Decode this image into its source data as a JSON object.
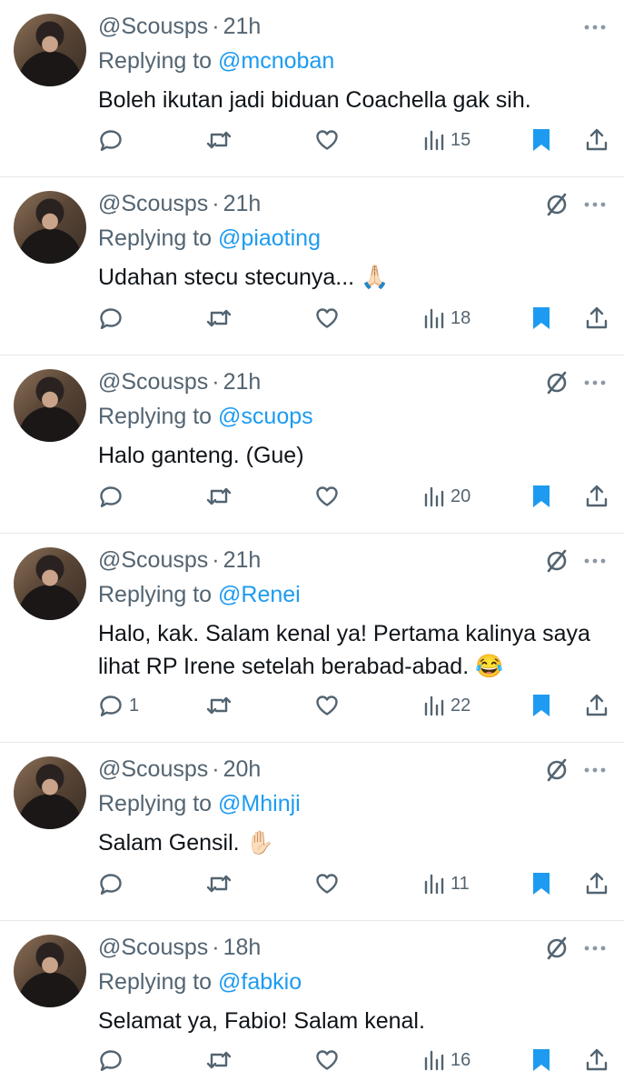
{
  "colors": {
    "accent": "#1d9bf0",
    "muted": "#536471",
    "text": "#0f1419",
    "divider": "#e6e8ea"
  },
  "icons": {
    "reply": "reply-icon",
    "retweet": "retweet-icon",
    "like": "heart-icon",
    "views": "views-icon",
    "bookmark": "bookmark-icon",
    "share": "share-icon",
    "mute": "muted-icon",
    "more": "more-icon"
  },
  "tweets": [
    {
      "handle": "@Scousps",
      "time": "21h",
      "replying_label": "Replying to",
      "mention": "@mcnoban",
      "text": "Boleh ikutan jadi biduan Coachella gak sih.",
      "emoji": "",
      "reply_count": "",
      "views": "15",
      "show_mute": false
    },
    {
      "handle": "@Scousps",
      "time": "21h",
      "replying_label": "Replying to",
      "mention": "@piaoting",
      "text": "Udahan stecu stecunya...",
      "emoji": "🙏🏻",
      "reply_count": "",
      "views": "18",
      "show_mute": true
    },
    {
      "handle": "@Scousps",
      "time": "21h",
      "replying_label": "Replying to",
      "mention": "@scuops",
      "text": "Halo ganteng. (Gue)",
      "emoji": "",
      "reply_count": "",
      "views": "20",
      "show_mute": true
    },
    {
      "handle": "@Scousps",
      "time": "21h",
      "replying_label": "Replying to",
      "mention": "@Renei",
      "text": "Halo, kak. Salam kenal ya! Pertama kalinya saya lihat RP Irene setelah berabad-abad.",
      "emoji": "😂",
      "reply_count": "1",
      "views": "22",
      "show_mute": true
    },
    {
      "handle": "@Scousps",
      "time": "20h",
      "replying_label": "Replying to",
      "mention": "@Mhinji",
      "text": "Salam Gensil.",
      "emoji": "✋🏻",
      "reply_count": "",
      "views": "11",
      "show_mute": true
    },
    {
      "handle": "@Scousps",
      "time": "18h",
      "replying_label": "Replying to",
      "mention": "@fabkio",
      "text": "Selamat ya, Fabio! Salam kenal.",
      "emoji": "",
      "reply_count": "",
      "views": "16",
      "show_mute": true
    }
  ]
}
